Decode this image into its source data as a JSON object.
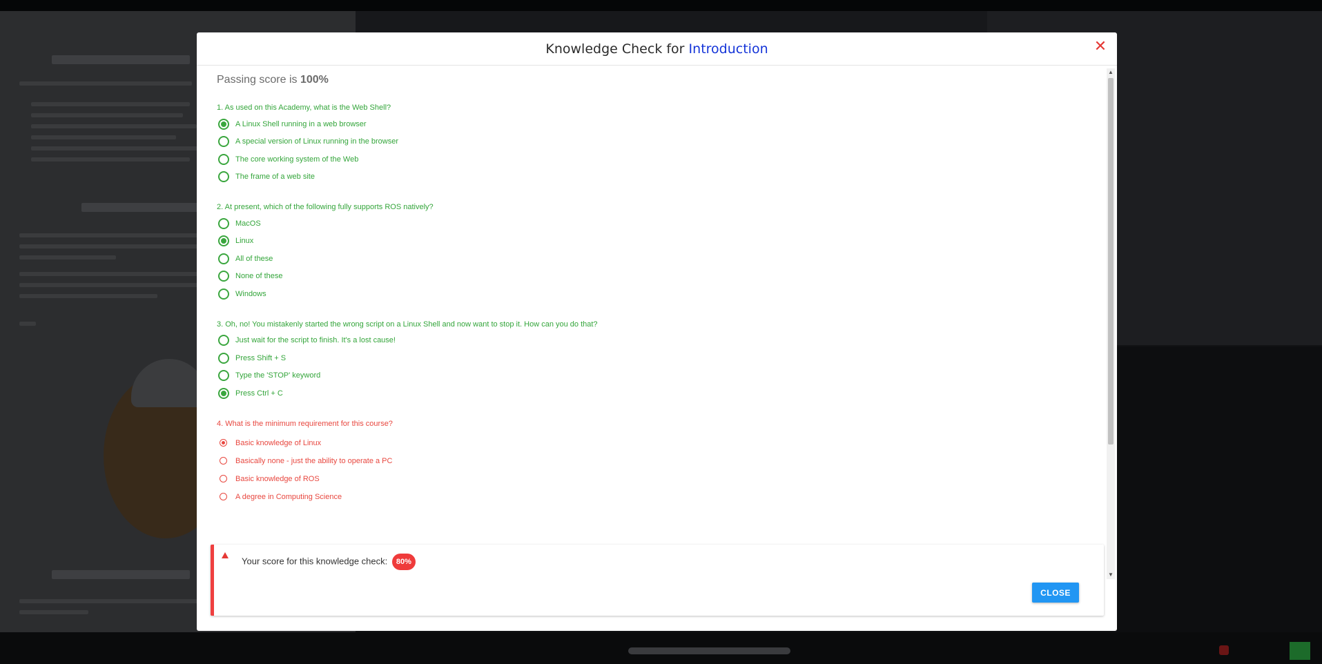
{
  "modal": {
    "title_prefix": "Knowledge Check for",
    "title_highlight": "Introduction",
    "close_icon": "close-x-icon",
    "passing_prefix": "Passing score is",
    "passing_value": "100%"
  },
  "questions": [
    {
      "text": "1. As used on this Academy, what is the Web Shell?",
      "state": "correct",
      "options": [
        {
          "label": "A Linux Shell running in a web browser",
          "checked": true
        },
        {
          "label": "A special version of Linux running in the browser",
          "checked": false
        },
        {
          "label": "The core working system of the Web",
          "checked": false
        },
        {
          "label": "The frame of a web site",
          "checked": false
        }
      ]
    },
    {
      "text": "2. At present, which of the following fully supports ROS natively?",
      "state": "correct",
      "options": [
        {
          "label": "MacOS",
          "checked": false
        },
        {
          "label": "Linux",
          "checked": true
        },
        {
          "label": "All of these",
          "checked": false
        },
        {
          "label": "None of these",
          "checked": false
        },
        {
          "label": "Windows",
          "checked": false
        }
      ]
    },
    {
      "text": "3. Oh, no! You mistakenly started the wrong script on a Linux Shell and now want to stop it. How can you do that?",
      "state": "correct",
      "options": [
        {
          "label": "Just wait for the script to finish. It's a lost cause!",
          "checked": false
        },
        {
          "label": "Press Shift + S",
          "checked": false
        },
        {
          "label": "Type the 'STOP' keyword",
          "checked": false
        },
        {
          "label": "Press Ctrl + C",
          "checked": true
        }
      ]
    },
    {
      "text": "4. What is the minimum requirement for this course?",
      "state": "wrong",
      "options": [
        {
          "label": "Basic knowledge of Linux",
          "checked": true
        },
        {
          "label": "Basically none - just the ability to operate a PC",
          "checked": false
        },
        {
          "label": "Basic knowledge of ROS",
          "checked": false
        },
        {
          "label": "A degree in Computing Science",
          "checked": false
        }
      ]
    }
  ],
  "result": {
    "icon": "warning-icon",
    "score_label": "Your score for this knowledge check:",
    "score_value": "80%",
    "close_label": "CLOSE"
  },
  "colors": {
    "correct": "#33a53a",
    "wrong": "#e8473f",
    "title_highlight": "#1434d8",
    "button": "#2196f3"
  }
}
